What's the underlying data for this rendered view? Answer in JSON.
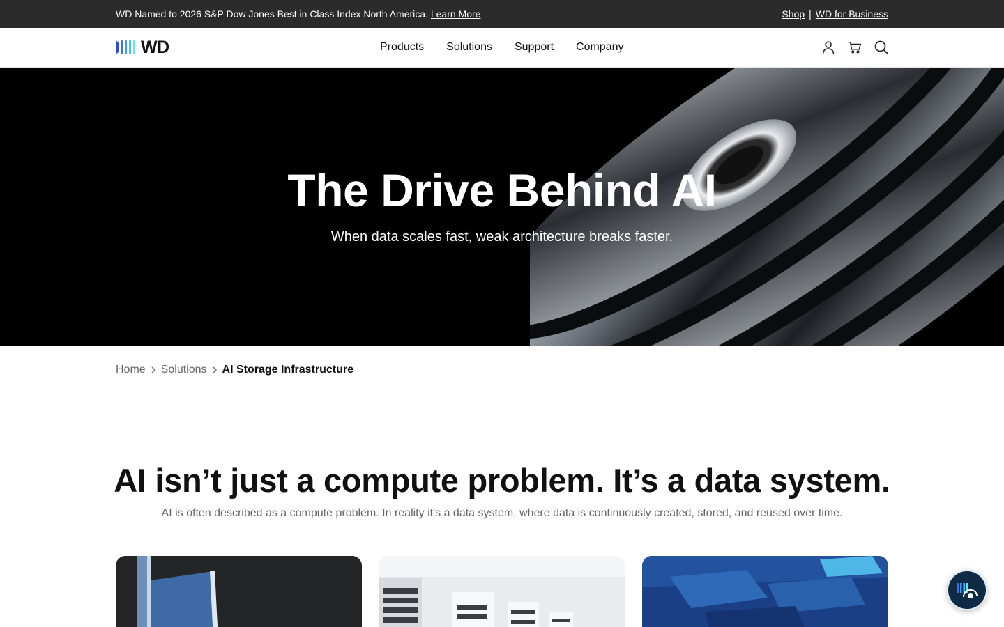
{
  "announcement": {
    "text": "WD Named to 2026 S&P Dow Jones Best in Class Index North America.",
    "link": "Learn More",
    "shop": "Shop",
    "separator": "|",
    "business": "WD for Business"
  },
  "header": {
    "logo_text": "WD",
    "nav": [
      "Products",
      "Solutions",
      "Support",
      "Company"
    ],
    "icons": [
      "account-icon",
      "cart-icon",
      "search-icon"
    ]
  },
  "hero": {
    "title": "The Drive Behind AI",
    "subtitle": "When data scales fast, weak architecture breaks faster."
  },
  "breadcrumb": {
    "items": [
      "Home",
      "Solutions"
    ],
    "current": "AI Storage Infrastructure"
  },
  "section": {
    "title": "AI isn’t just a compute problem. It’s a data system.",
    "subtitle": "AI is often described as a compute problem. In reality it's a data system, where data is continuously created, stored, and reused over time."
  },
  "chat": {
    "icon": "chat-support-icon"
  },
  "colors": {
    "topbar": "#2b2b2b",
    "hero_bg": "#000000",
    "chat_bg": "#0f2a44",
    "logo_blue": "#2e4bd6",
    "logo_cyan": "#40c4f2"
  }
}
